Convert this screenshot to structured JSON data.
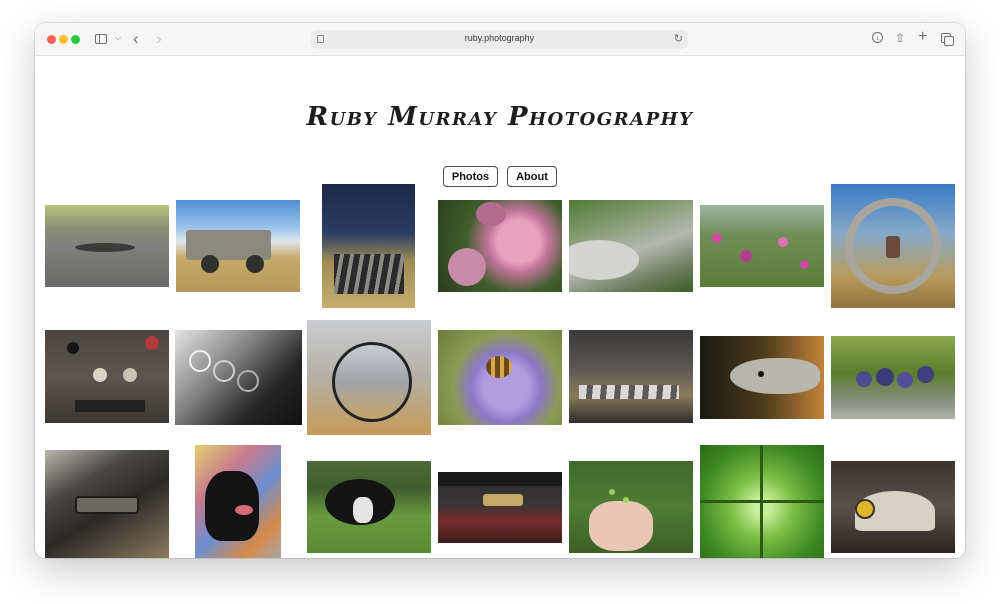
{
  "browser": {
    "url": "ruby.photography"
  },
  "site": {
    "title": "Ruby Murray Photography",
    "nav": [
      {
        "label": "Photos"
      },
      {
        "label": "About"
      }
    ]
  },
  "gallery": {
    "photos": [
      {
        "name": "photo-lizard"
      },
      {
        "name": "photo-old-truck"
      },
      {
        "name": "photo-harvester-header"
      },
      {
        "name": "photo-pink-roses"
      },
      {
        "name": "photo-fern-and-rocks"
      },
      {
        "name": "photo-wildflowers"
      },
      {
        "name": "photo-machine-ring-reflection"
      },
      {
        "name": "photo-control-panel"
      },
      {
        "name": "photo-bw-dashboard"
      },
      {
        "name": "photo-side-mirror"
      },
      {
        "name": "photo-bee-on-cornflower"
      },
      {
        "name": "photo-grain-machinery"
      },
      {
        "name": "photo-snake-head"
      },
      {
        "name": "photo-blueberries"
      },
      {
        "name": "photo-door-handle"
      },
      {
        "name": "photo-black-dog"
      },
      {
        "name": "photo-collie-in-grass"
      },
      {
        "name": "photo-grain-on-metal"
      },
      {
        "name": "photo-hand-with-flowers"
      },
      {
        "name": "photo-palm-fronds"
      },
      {
        "name": "photo-miner-helmet"
      }
    ]
  }
}
